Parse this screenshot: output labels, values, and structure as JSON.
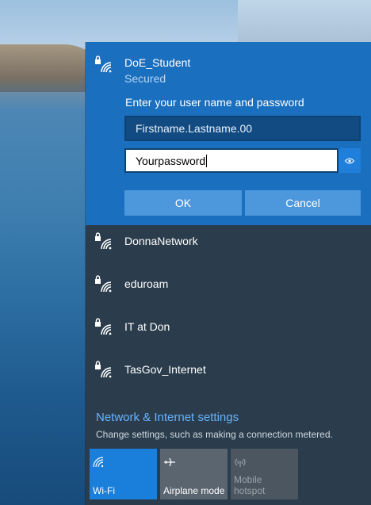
{
  "colors": {
    "selected_bg": "#1a6fbf",
    "panel_bg": "#2b3d4c",
    "button_bg": "#4d98dd",
    "link": "#67b3ff",
    "tile_active": "#1a7fdb",
    "tile_inactive": "#5a6570"
  },
  "selected_network": {
    "name": "DoE_Student",
    "status": "Secured",
    "prompt": "Enter your user name and password",
    "username_value": "Firstname.Lastname.00",
    "password_value": "Yourpassword",
    "ok_label": "OK",
    "cancel_label": "Cancel"
  },
  "networks": [
    {
      "name": "DonnaNetwork",
      "icon": "wifi-secured-icon"
    },
    {
      "name": "eduroam",
      "icon": "wifi-secured-icon"
    },
    {
      "name": "IT at Don",
      "icon": "wifi-secured-icon"
    },
    {
      "name": "TasGov_Internet",
      "icon": "wifi-secured-icon"
    }
  ],
  "settings": {
    "link_text": "Network & Internet settings",
    "description": "Change settings, such as making a connection metered."
  },
  "quick_actions": [
    {
      "label": "Wi-Fi",
      "icon": "wifi-icon",
      "state": "on"
    },
    {
      "label": "Airplane mode",
      "icon": "airplane-icon",
      "state": "off"
    },
    {
      "label_line1": "Mobile",
      "label_line2": "hotspot",
      "icon": "mobile-hotspot-icon",
      "state": "disabled"
    }
  ]
}
